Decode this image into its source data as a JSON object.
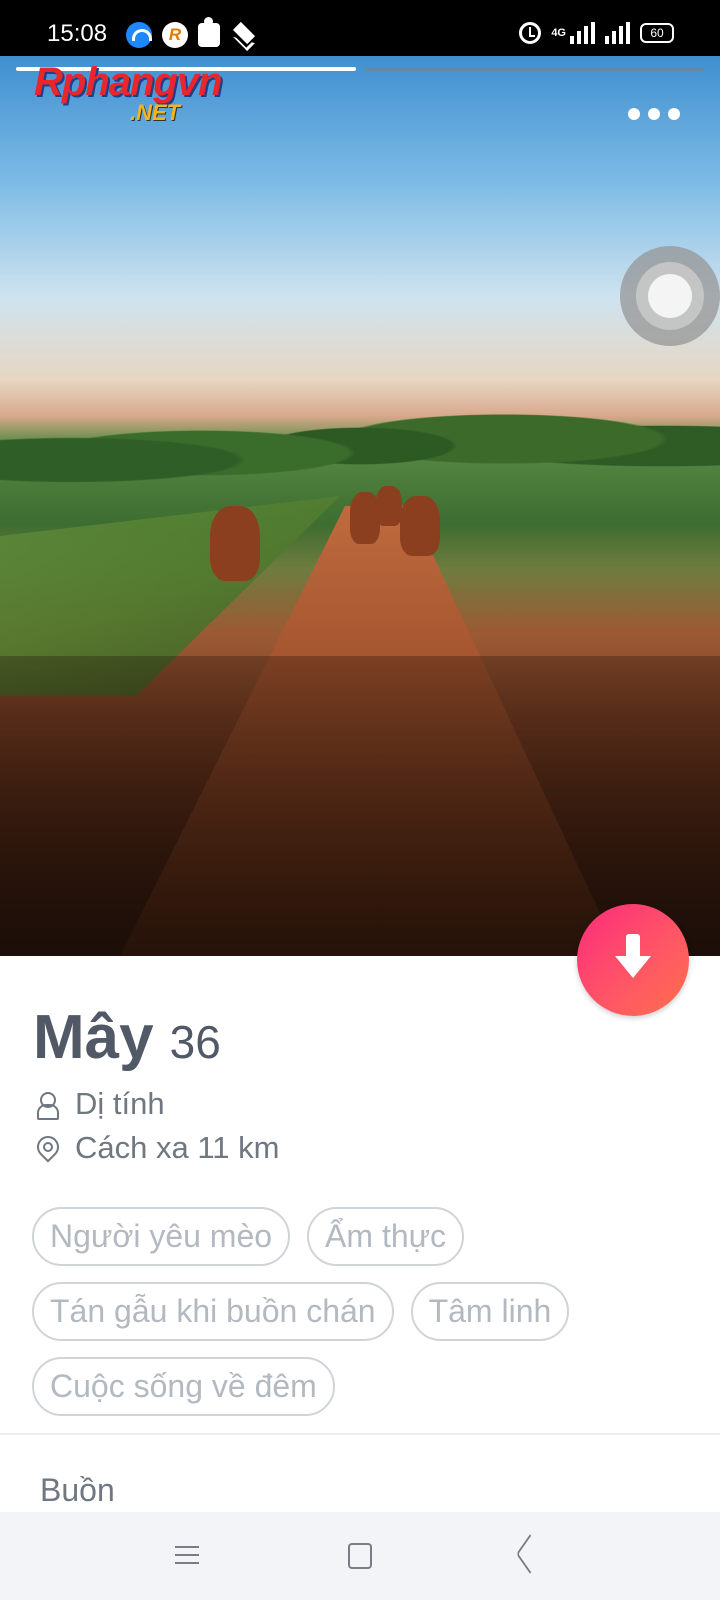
{
  "status_bar": {
    "time": "15:08",
    "network": "4G",
    "battery": "60",
    "icons": [
      "wifi-icon",
      "app-r-icon",
      "puzzle-icon",
      "layers-icon",
      "alarm-icon",
      "signal-icon",
      "signal-icon",
      "battery-icon"
    ]
  },
  "photo": {
    "watermark_main": "Rphangvn",
    "watermark_sub": ".NET",
    "photo_count": 2,
    "current_photo": 1
  },
  "profile": {
    "name": "Mây",
    "age": "36",
    "orientation": "Dị tính",
    "distance": "Cách xa 11 km",
    "interests": [
      "Người yêu mèo",
      "Ẩm thực",
      "Tán gẫu khi buồn chán",
      "Tâm linh",
      "Cuộc sống về đêm"
    ],
    "bio": "Buồn"
  },
  "colors": {
    "accent_gradient_start": "#fd2b7b",
    "accent_gradient_end": "#ff6f4a",
    "text_primary": "#505965",
    "tag_border": "#cfd4da"
  }
}
